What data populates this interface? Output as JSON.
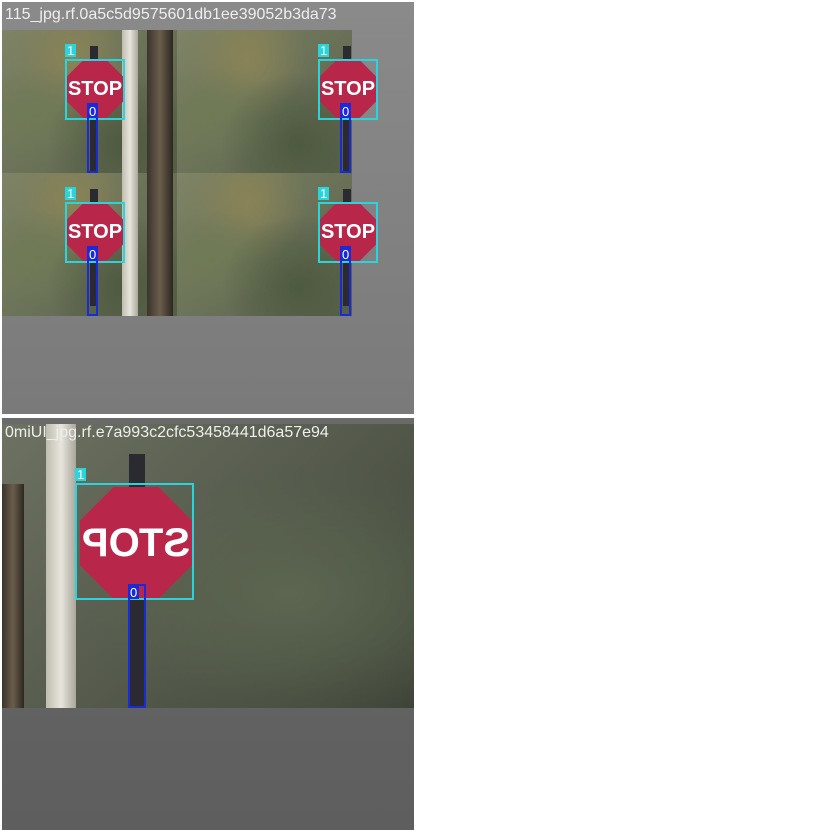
{
  "panels": [
    {
      "title": "115_jpg.rf.0a5c5d9575601db1ee39052b3da73",
      "sign_text": "STOP",
      "mosaic": true,
      "detections": [
        {
          "class": "1",
          "color": "#29d4dc"
        },
        {
          "class": "0",
          "color": "#1b2ad9"
        }
      ]
    },
    {
      "title": "0miUI_jpg.rf.e7a993c2cfc53458441d6a57e94",
      "sign_text": "STOP",
      "mirrored": true,
      "detections": [
        {
          "class": "1",
          "color": "#29d4dc"
        },
        {
          "class": "0",
          "color": "#1b2ad9"
        }
      ]
    }
  ]
}
